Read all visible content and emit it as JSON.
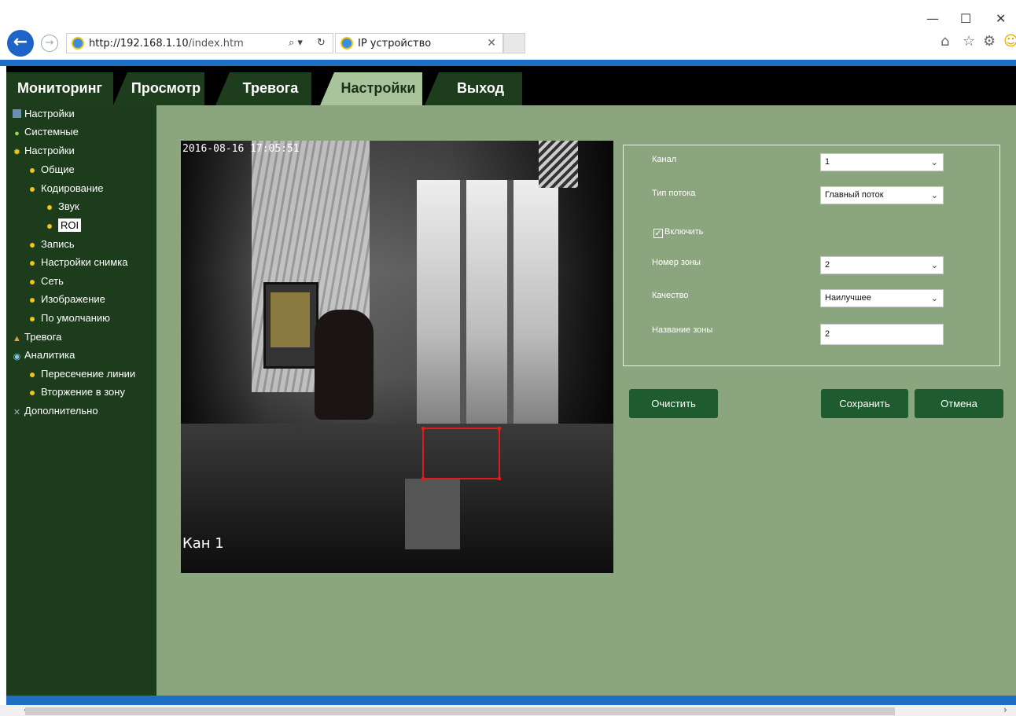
{
  "browser": {
    "url_host": "http://192.168.1.10",
    "url_path": "/index.htm",
    "tab_title": "IP устройство",
    "icons": [
      "back-icon",
      "forward-icon",
      "search-icon",
      "refresh-icon",
      "home-icon",
      "star-icon",
      "gear-icon",
      "smiley-icon"
    ]
  },
  "nav": {
    "tabs": [
      {
        "label": "Мониторинг"
      },
      {
        "label": "Просмотр"
      },
      {
        "label": "Тревога"
      },
      {
        "label": "Настройки",
        "active": true
      },
      {
        "label": "Выход"
      }
    ]
  },
  "sidebar": {
    "items": [
      {
        "label": "Настройки",
        "icon": "settings-icon"
      },
      {
        "label": "Системные",
        "icon": "system-icon"
      },
      {
        "label": "Настройки",
        "icon": "gear-icon"
      },
      {
        "label": "Общие"
      },
      {
        "label": "Кодирование"
      },
      {
        "label": "Звук"
      },
      {
        "label": "ROI",
        "selected": true
      },
      {
        "label": "Запись"
      },
      {
        "label": "Настройки снимка"
      },
      {
        "label": "Сеть"
      },
      {
        "label": "Изображение"
      },
      {
        "label": "По умолчанию"
      },
      {
        "label": "Тревога",
        "icon": "bell-icon"
      },
      {
        "label": "Аналитика",
        "icon": "analytics-icon"
      },
      {
        "label": "Пересечение линии"
      },
      {
        "label": "Вторжение в зону"
      },
      {
        "label": "Дополнительно",
        "icon": "tools-icon"
      }
    ]
  },
  "video": {
    "timestamp": "2016-08-16 17:05:51",
    "channel_label": "Кан 1"
  },
  "form": {
    "channel_label": "Канал",
    "channel_value": "1",
    "stream_type_label": "Тип потока",
    "stream_type_value": "Главный поток",
    "enable_label": "Включить",
    "enable_checked": true,
    "zone_number_label": "Номер зоны",
    "zone_number_value": "2",
    "quality_label": "Качество",
    "quality_value": "Наилучшее",
    "zone_name_label": "Название зоны",
    "zone_name_value": "2"
  },
  "buttons": {
    "clear": "Очистить",
    "save": "Сохранить",
    "cancel": "Отмена"
  },
  "colors": {
    "nav_bg": "#000000",
    "sidebar_bg": "#1c3c1c",
    "content_bg": "#8ba67f",
    "button_bg": "#1e5b2e",
    "accent_blue": "#1e6fc4",
    "roi_red": "#e01b1b"
  }
}
